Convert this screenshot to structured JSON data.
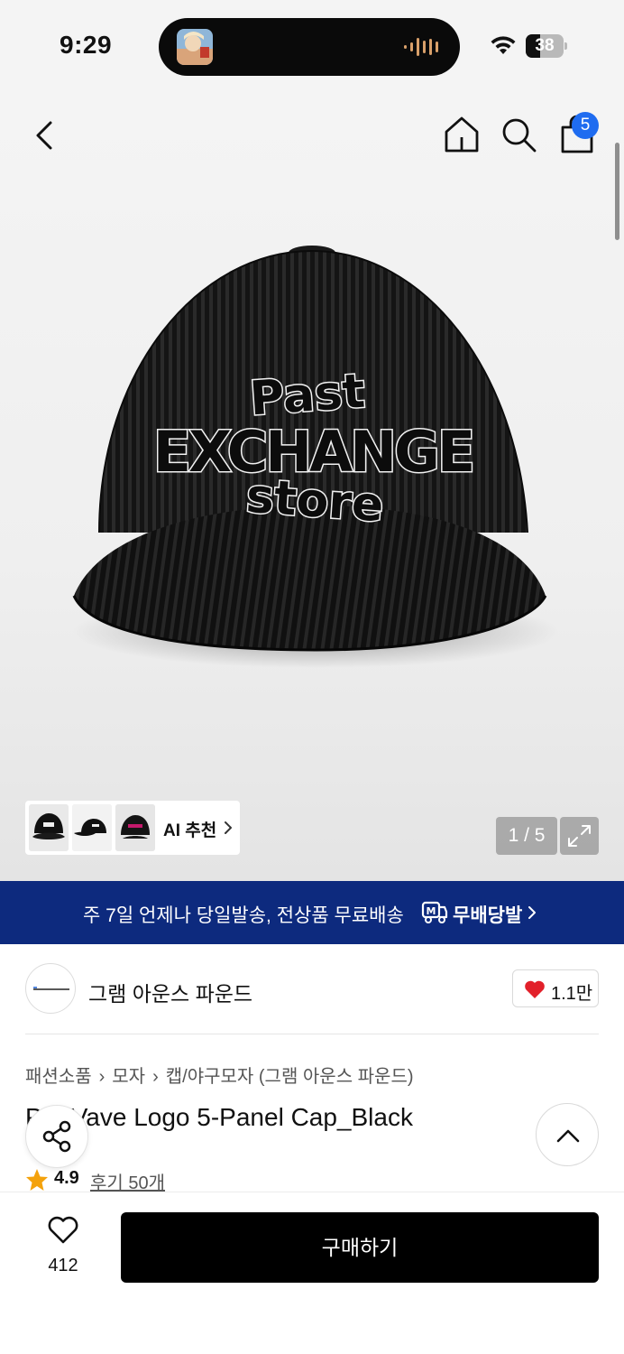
{
  "status_bar": {
    "time": "9:29",
    "battery": "38",
    "battery_level": 0.38
  },
  "header": {
    "cart_count": "5"
  },
  "hero": {
    "cap_logo_text": [
      "Past",
      "EXCHANGE",
      "store"
    ],
    "ai_recommend_label": "AI 추천",
    "page_counter": "1 / 5"
  },
  "promo": {
    "text": "주 7일 언제나 당일발송, 전상품 무료배송",
    "brand": "무배당발"
  },
  "brand": {
    "name": "그램 아운스 파운드",
    "like_count": "1.1만"
  },
  "breadcrumb": {
    "items": [
      "패션소품",
      "모자",
      "캡/야구모자 (그램 아운스 파운드)"
    ]
  },
  "product": {
    "title_visible": "Vave Logo 5-Panel Cap_Black",
    "title_prefix": "P",
    "rating": "4.9",
    "reviews": "후기 50개"
  },
  "bottom": {
    "wish_count": "412",
    "buy_label": "구매하기"
  },
  "colors": {
    "accent_blue": "#1f6cf0",
    "promo_navy": "#0d2a7e",
    "heart_red": "#e2202a",
    "star_orange": "#f4a20c"
  }
}
